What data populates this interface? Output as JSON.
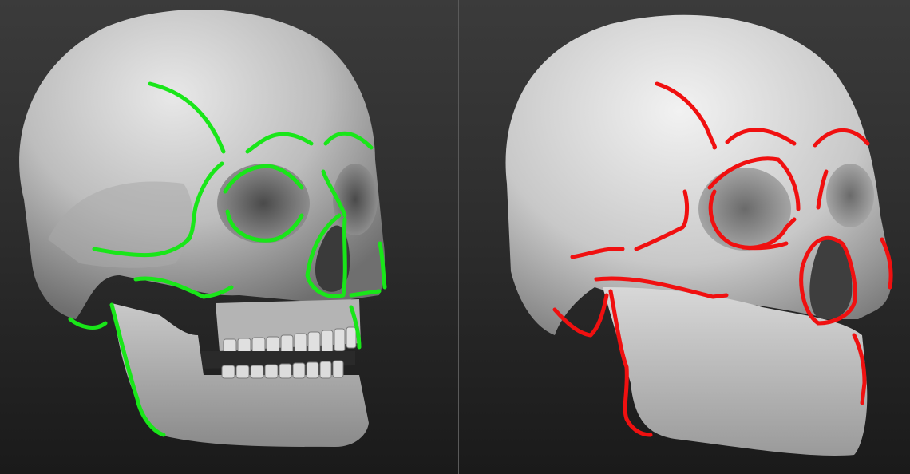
{
  "figure": {
    "left_panel": {
      "subject": "detailed-skull-sculpt",
      "overlay_color": "#19e619"
    },
    "right_panel": {
      "subject": "simplified-skull-sculpt",
      "overlay_color": "#f01010"
    },
    "background_color": "#2b2b2b",
    "divider_color": "#5a5a5a"
  }
}
